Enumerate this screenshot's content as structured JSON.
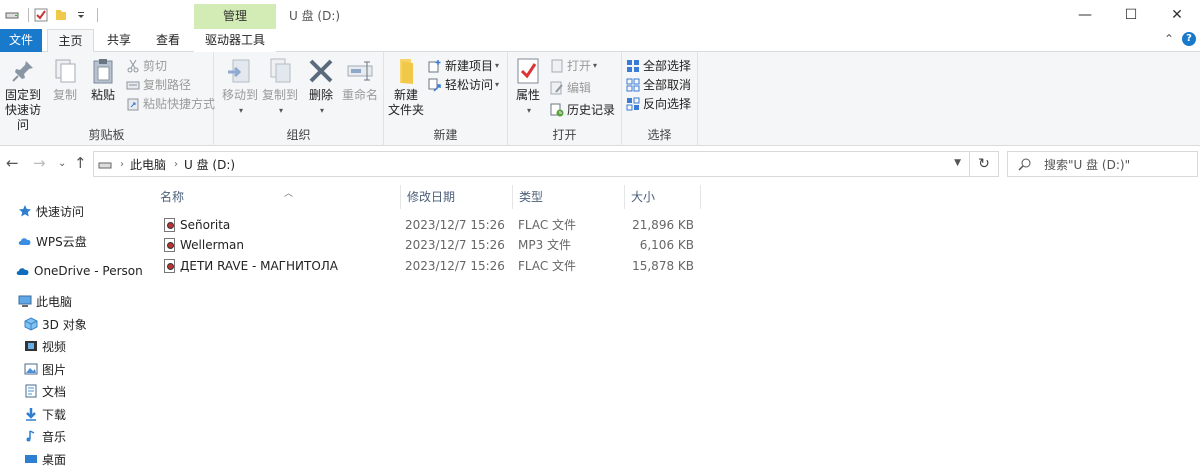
{
  "window": {
    "title": "U 盘 (D:)",
    "context_tab": "管理",
    "minimize": "—",
    "maximize": "☐",
    "close": "✕"
  },
  "ribbon_tabs": {
    "file": "文件",
    "home": "主页",
    "share": "共享",
    "view": "查看",
    "drive_tools": "驱动器工具",
    "collapse": "⌃",
    "help": "?"
  },
  "ribbon": {
    "clipboard": {
      "label": "剪贴板",
      "pin_line1": "固定到",
      "pin_line2": "快速访问",
      "copy": "复制",
      "paste": "粘贴",
      "cut": "剪切",
      "copy_path": "复制路径",
      "paste_shortcut": "粘贴快捷方式"
    },
    "organize": {
      "label": "组织",
      "move_to": "移动到",
      "copy_to": "复制到",
      "delete": "删除",
      "rename": "重命名"
    },
    "new": {
      "label": "新建",
      "new_folder_line1": "新建",
      "new_folder_line2": "文件夹",
      "new_item": "新建项目",
      "easy_access": "轻松访问"
    },
    "open": {
      "label": "打开",
      "properties": "属性",
      "open": "打开",
      "edit": "编辑",
      "history": "历史记录"
    },
    "select": {
      "label": "选择",
      "select_all": "全部选择",
      "select_none": "全部取消",
      "invert": "反向选择"
    }
  },
  "address": {
    "crumb_root": "此电脑",
    "crumb_drive": "U 盘 (D:)",
    "search_placeholder": "搜索\"U 盘 (D:)\""
  },
  "nav_pane": {
    "quick_access": "快速访问",
    "wps": "WPS云盘",
    "onedrive": "OneDrive - Persona",
    "this_pc": "此电脑",
    "objects3d": "3D 对象",
    "videos": "视频",
    "pictures": "图片",
    "documents": "文档",
    "downloads": "下载",
    "music": "音乐",
    "desktop": "桌面"
  },
  "columns": {
    "name": "名称",
    "modified": "修改日期",
    "type": "类型",
    "size": "大小"
  },
  "files": [
    {
      "name": "Señorita",
      "modified": "2023/12/7 15:26",
      "type": "FLAC 文件",
      "size": "21,896 KB"
    },
    {
      "name": "Wellerman",
      "modified": "2023/12/7 15:26",
      "type": "MP3 文件",
      "size": "6,106 KB"
    },
    {
      "name": "ДЕТИ RAVE - МАГНИТОЛА",
      "modified": "2023/12/7 15:26",
      "type": "FLAC 文件",
      "size": "15,878 KB"
    }
  ],
  "colors": {
    "accent": "#1979ca",
    "manage_tab": "#d3ecb5",
    "ribbon_bg": "#f5f6f7"
  }
}
